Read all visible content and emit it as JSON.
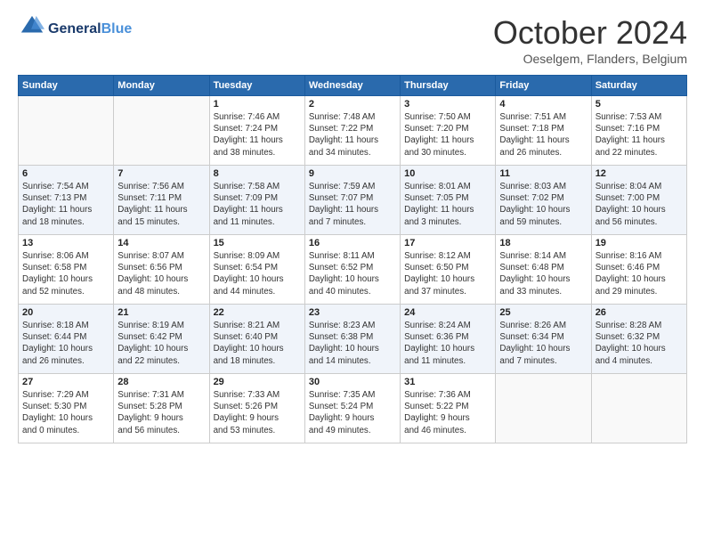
{
  "header": {
    "logo_line1": "General",
    "logo_line2": "Blue",
    "month_title": "October 2024",
    "location": "Oeselgem, Flanders, Belgium"
  },
  "weekdays": [
    "Sunday",
    "Monday",
    "Tuesday",
    "Wednesday",
    "Thursday",
    "Friday",
    "Saturday"
  ],
  "weeks": [
    [
      {
        "day": "",
        "info": ""
      },
      {
        "day": "",
        "info": ""
      },
      {
        "day": "1",
        "info": "Sunrise: 7:46 AM\nSunset: 7:24 PM\nDaylight: 11 hours\nand 38 minutes."
      },
      {
        "day": "2",
        "info": "Sunrise: 7:48 AM\nSunset: 7:22 PM\nDaylight: 11 hours\nand 34 minutes."
      },
      {
        "day": "3",
        "info": "Sunrise: 7:50 AM\nSunset: 7:20 PM\nDaylight: 11 hours\nand 30 minutes."
      },
      {
        "day": "4",
        "info": "Sunrise: 7:51 AM\nSunset: 7:18 PM\nDaylight: 11 hours\nand 26 minutes."
      },
      {
        "day": "5",
        "info": "Sunrise: 7:53 AM\nSunset: 7:16 PM\nDaylight: 11 hours\nand 22 minutes."
      }
    ],
    [
      {
        "day": "6",
        "info": "Sunrise: 7:54 AM\nSunset: 7:13 PM\nDaylight: 11 hours\nand 18 minutes."
      },
      {
        "day": "7",
        "info": "Sunrise: 7:56 AM\nSunset: 7:11 PM\nDaylight: 11 hours\nand 15 minutes."
      },
      {
        "day": "8",
        "info": "Sunrise: 7:58 AM\nSunset: 7:09 PM\nDaylight: 11 hours\nand 11 minutes."
      },
      {
        "day": "9",
        "info": "Sunrise: 7:59 AM\nSunset: 7:07 PM\nDaylight: 11 hours\nand 7 minutes."
      },
      {
        "day": "10",
        "info": "Sunrise: 8:01 AM\nSunset: 7:05 PM\nDaylight: 11 hours\nand 3 minutes."
      },
      {
        "day": "11",
        "info": "Sunrise: 8:03 AM\nSunset: 7:02 PM\nDaylight: 10 hours\nand 59 minutes."
      },
      {
        "day": "12",
        "info": "Sunrise: 8:04 AM\nSunset: 7:00 PM\nDaylight: 10 hours\nand 56 minutes."
      }
    ],
    [
      {
        "day": "13",
        "info": "Sunrise: 8:06 AM\nSunset: 6:58 PM\nDaylight: 10 hours\nand 52 minutes."
      },
      {
        "day": "14",
        "info": "Sunrise: 8:07 AM\nSunset: 6:56 PM\nDaylight: 10 hours\nand 48 minutes."
      },
      {
        "day": "15",
        "info": "Sunrise: 8:09 AM\nSunset: 6:54 PM\nDaylight: 10 hours\nand 44 minutes."
      },
      {
        "day": "16",
        "info": "Sunrise: 8:11 AM\nSunset: 6:52 PM\nDaylight: 10 hours\nand 40 minutes."
      },
      {
        "day": "17",
        "info": "Sunrise: 8:12 AM\nSunset: 6:50 PM\nDaylight: 10 hours\nand 37 minutes."
      },
      {
        "day": "18",
        "info": "Sunrise: 8:14 AM\nSunset: 6:48 PM\nDaylight: 10 hours\nand 33 minutes."
      },
      {
        "day": "19",
        "info": "Sunrise: 8:16 AM\nSunset: 6:46 PM\nDaylight: 10 hours\nand 29 minutes."
      }
    ],
    [
      {
        "day": "20",
        "info": "Sunrise: 8:18 AM\nSunset: 6:44 PM\nDaylight: 10 hours\nand 26 minutes."
      },
      {
        "day": "21",
        "info": "Sunrise: 8:19 AM\nSunset: 6:42 PM\nDaylight: 10 hours\nand 22 minutes."
      },
      {
        "day": "22",
        "info": "Sunrise: 8:21 AM\nSunset: 6:40 PM\nDaylight: 10 hours\nand 18 minutes."
      },
      {
        "day": "23",
        "info": "Sunrise: 8:23 AM\nSunset: 6:38 PM\nDaylight: 10 hours\nand 14 minutes."
      },
      {
        "day": "24",
        "info": "Sunrise: 8:24 AM\nSunset: 6:36 PM\nDaylight: 10 hours\nand 11 minutes."
      },
      {
        "day": "25",
        "info": "Sunrise: 8:26 AM\nSunset: 6:34 PM\nDaylight: 10 hours\nand 7 minutes."
      },
      {
        "day": "26",
        "info": "Sunrise: 8:28 AM\nSunset: 6:32 PM\nDaylight: 10 hours\nand 4 minutes."
      }
    ],
    [
      {
        "day": "27",
        "info": "Sunrise: 7:29 AM\nSunset: 5:30 PM\nDaylight: 10 hours\nand 0 minutes."
      },
      {
        "day": "28",
        "info": "Sunrise: 7:31 AM\nSunset: 5:28 PM\nDaylight: 9 hours\nand 56 minutes."
      },
      {
        "day": "29",
        "info": "Sunrise: 7:33 AM\nSunset: 5:26 PM\nDaylight: 9 hours\nand 53 minutes."
      },
      {
        "day": "30",
        "info": "Sunrise: 7:35 AM\nSunset: 5:24 PM\nDaylight: 9 hours\nand 49 minutes."
      },
      {
        "day": "31",
        "info": "Sunrise: 7:36 AM\nSunset: 5:22 PM\nDaylight: 9 hours\nand 46 minutes."
      },
      {
        "day": "",
        "info": ""
      },
      {
        "day": "",
        "info": ""
      }
    ]
  ]
}
